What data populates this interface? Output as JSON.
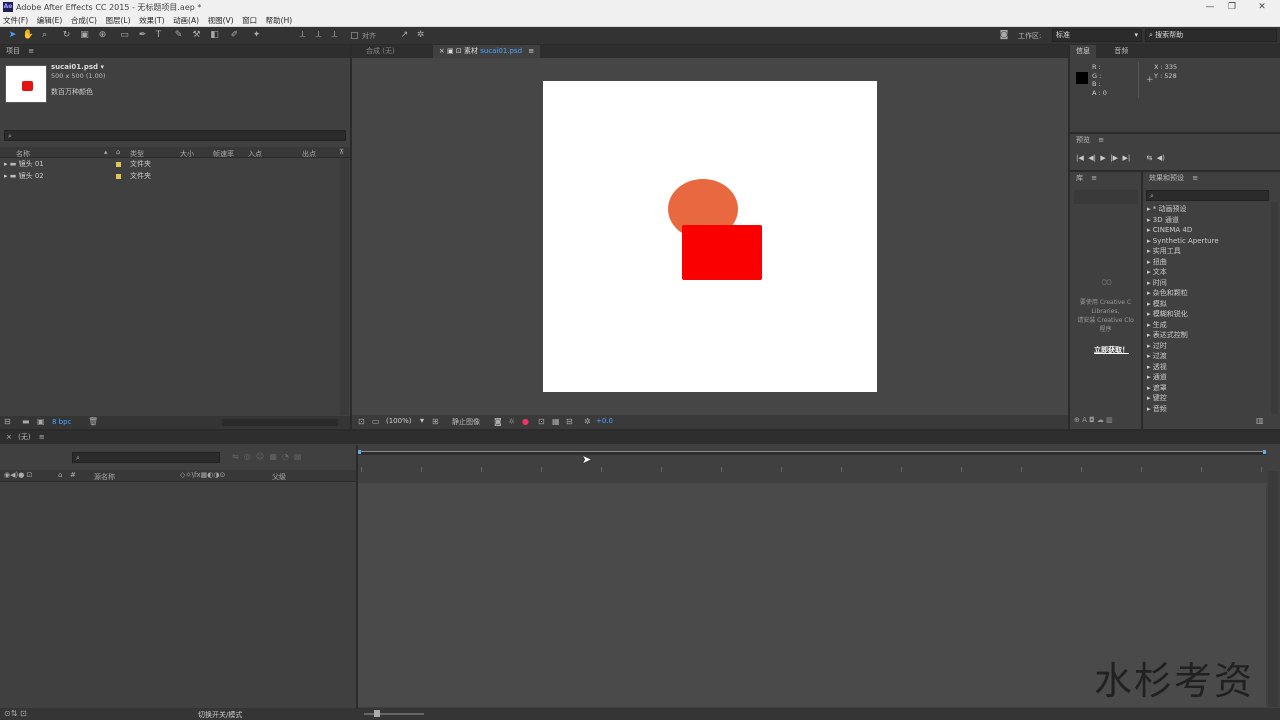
{
  "window": {
    "title": "Adobe After Effects CC 2015 - 无标题项目.aep *",
    "app_logo": "Ae",
    "minimize": "—",
    "maximize": "❐",
    "close": "✕"
  },
  "menu": [
    "文件(F)",
    "编辑(E)",
    "合成(C)",
    "图层(L)",
    "效果(T)",
    "动画(A)",
    "视图(V)",
    "窗口",
    "帮助(H)"
  ],
  "toolbar": {
    "snap_label": "对齐",
    "workspace_label": "工作区:",
    "workspace_value": "标准",
    "search_help": "搜索帮助"
  },
  "project": {
    "panel_title": "项目",
    "item_name": "sucai01.psd ▾",
    "item_dims": "500 x 500 (1.00)",
    "item_colors": "数百万种颜色",
    "search_icon": "⌕",
    "columns": [
      "名称",
      "类型",
      "大小",
      "帧速率",
      "入点",
      "出点"
    ],
    "items": [
      {
        "name": "镜头 01",
        "type": "文件夹"
      },
      {
        "name": "镜头 02",
        "type": "文件夹"
      }
    ],
    "bpc": "8 bpc"
  },
  "viewer": {
    "tab_comp": "合成 (无)",
    "tab_footage": "素材",
    "tab_footage_file": "sucai01.psd",
    "zoom": "(100%)",
    "status": "静止图像",
    "exposure": "+0.0",
    "colors": {
      "circle": "#e8683f",
      "rect": "#fa0000",
      "bg": "#ffffff"
    }
  },
  "info": {
    "tab_info": "信息",
    "tab_audio": "音频",
    "r": "R :",
    "g": "G :",
    "b": "B :",
    "a": "A : 0",
    "x": "X : 335",
    "y": "Y : 528"
  },
  "preview": {
    "title": "预览",
    "controls": [
      "|◀",
      "◀|",
      "▶",
      "|▶",
      "▶|"
    ]
  },
  "library": {
    "title": "库",
    "text1": "要使用 Creative C",
    "text2": "Libraries,",
    "text3": "请安装 Creative Clo",
    "text4": "程序",
    "link": "立即获取！"
  },
  "effects": {
    "title": "效果和预设",
    "items": [
      "* 动画预设",
      "3D 通道",
      "CINEMA 4D",
      "Synthetic Aperture",
      "实用工具",
      "扭曲",
      "文本",
      "时间",
      "杂色和颗粒",
      "模拟",
      "模糊和锐化",
      "生成",
      "表达式控制",
      "过时",
      "过渡",
      "透视",
      "通道",
      "遮罩",
      "键控",
      "音频"
    ]
  },
  "timeline": {
    "tab": "(无)",
    "search_icon": "⌕",
    "columns": [
      "源名称",
      "父级"
    ],
    "toggle_label": "切换开关/模式"
  },
  "watermark": "水杉考资"
}
